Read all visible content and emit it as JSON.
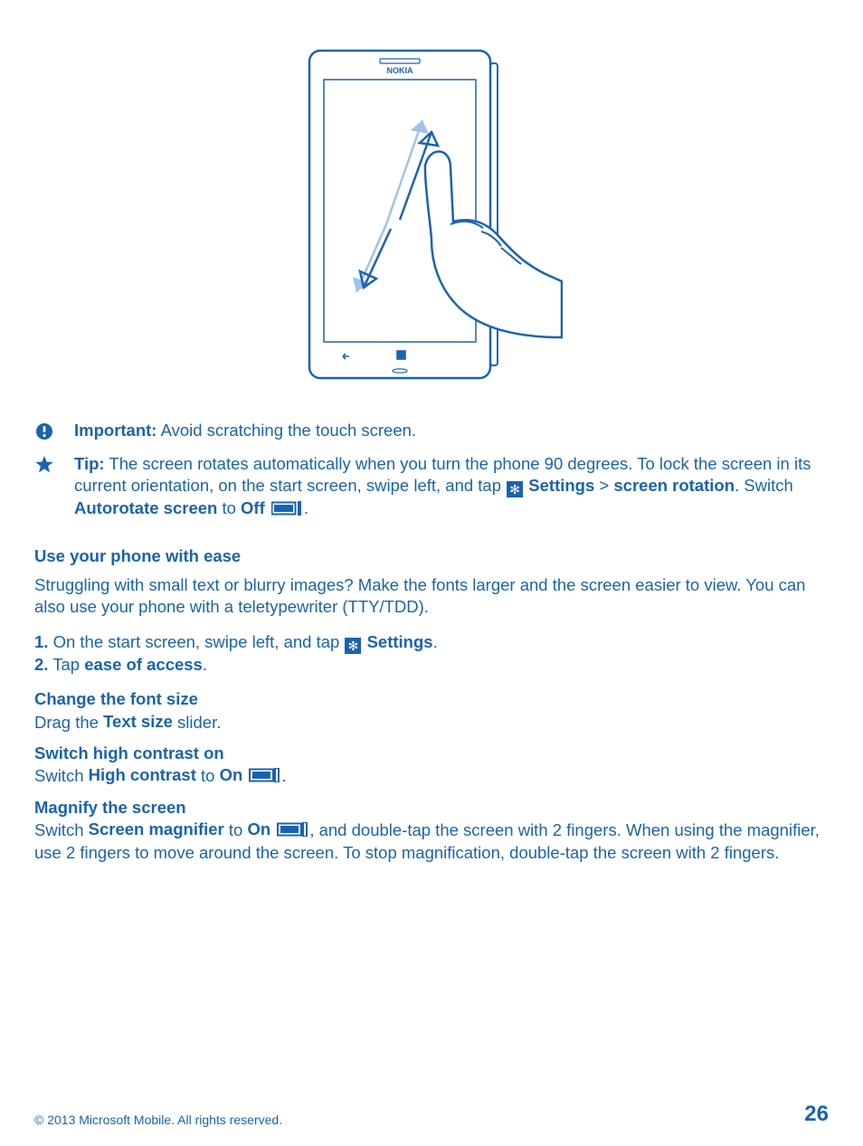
{
  "phone": {
    "brand": "NOKIA"
  },
  "notes": {
    "important": {
      "label": "Important:",
      "text": "Avoid scratching the touch screen."
    },
    "tip": {
      "label": "Tip:",
      "part1": "The screen rotates automatically when you turn the phone 90 degrees. To lock the screen in its current orientation, on the start screen, swipe left, and tap ",
      "settings": "Settings",
      "gt": ">",
      "rotation_b": "screen rotation",
      "switch1": ". Switch ",
      "autorotate": "Autorotate screen",
      "to": " to ",
      "off": "Off",
      "end": "."
    }
  },
  "section": {
    "ease_title": "Use your phone with ease",
    "ease_para": "Struggling with small text or blurry images? Make the fonts larger and the screen easier to view. You can also use your phone with a teletypewriter (TTY/TDD).",
    "step1_no": "1.",
    "step1_a": " On the start screen, swipe left, and tap ",
    "step1_settings": "Settings",
    "step1_end": ".",
    "step2_no": "2.",
    "step2_a": " Tap ",
    "step2_bold": "ease of access",
    "step2_end": ".",
    "font_h": "Change the font size",
    "font_a": "Drag the ",
    "font_b": "Text size",
    "font_c": " slider.",
    "hc_h": "Switch high contrast on",
    "hc_a": "Switch ",
    "hc_b": "High contrast",
    "hc_to": " to ",
    "hc_on": "On",
    "hc_end": ".",
    "mag_h": "Magnify the screen",
    "mag_a": "Switch ",
    "mag_b": "Screen magnifier",
    "mag_to": " to ",
    "mag_on": "On",
    "mag_c": ", and double-tap the screen with 2 fingers. When using the magnifier, use 2 fingers to move around the screen. To stop magnification, double-tap the screen with 2 fingers."
  },
  "footer": {
    "copyright": "© 2013 Microsoft Mobile. All rights reserved.",
    "page": "26"
  }
}
